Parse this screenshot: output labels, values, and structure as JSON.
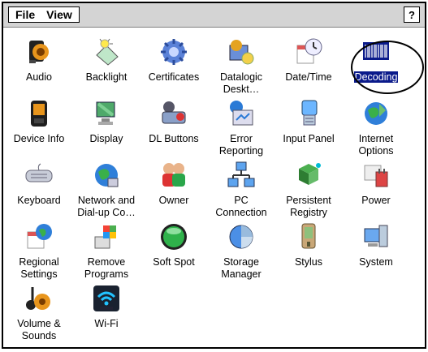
{
  "menubar": {
    "file_label": "File",
    "view_label": "View",
    "help_label": "?"
  },
  "items": [
    {
      "label": "Audio",
      "icon": "audio-speaker-icon"
    },
    {
      "label": "Backlight",
      "icon": "backlight-bulb-icon"
    },
    {
      "label": "Certificates",
      "icon": "certificates-gear-icon"
    },
    {
      "label": "Datalogic Deskt…",
      "icon": "datalogic-desktop-icon"
    },
    {
      "label": "Date/Time",
      "icon": "date-time-clock-icon"
    },
    {
      "label": "Decoding",
      "icon": "barcode-decoding-icon",
      "selected": true
    },
    {
      "label": "Device Info",
      "icon": "device-info-icon"
    },
    {
      "label": "Display",
      "icon": "display-monitor-icon"
    },
    {
      "label": "DL Buttons",
      "icon": "dl-buttons-icon"
    },
    {
      "label": "Error Reporting",
      "icon": "error-reporting-icon"
    },
    {
      "label": "Input Panel",
      "icon": "input-panel-icon"
    },
    {
      "label": "Internet Options",
      "icon": "internet-options-globe-icon"
    },
    {
      "label": "Keyboard",
      "icon": "keyboard-icon"
    },
    {
      "label": "Network and Dial-up Co…",
      "icon": "network-globe-icon"
    },
    {
      "label": "Owner",
      "icon": "owner-people-icon"
    },
    {
      "label": "PC Connection",
      "icon": "pc-connection-icon"
    },
    {
      "label": "Persistent Registry",
      "icon": "persistent-registry-icon"
    },
    {
      "label": "Power",
      "icon": "power-icon"
    },
    {
      "label": "Regional Settings",
      "icon": "regional-settings-icon"
    },
    {
      "label": "Remove Programs",
      "icon": "remove-programs-icon"
    },
    {
      "label": "Soft Spot",
      "icon": "soft-spot-icon"
    },
    {
      "label": "Storage Manager",
      "icon": "storage-manager-icon"
    },
    {
      "label": "Stylus",
      "icon": "stylus-icon"
    },
    {
      "label": "System",
      "icon": "system-icon"
    },
    {
      "label": "Volume & Sounds",
      "icon": "volume-sounds-icon"
    },
    {
      "label": "Wi-Fi",
      "icon": "wifi-icon"
    }
  ],
  "selection_color": "#0a1a8a"
}
